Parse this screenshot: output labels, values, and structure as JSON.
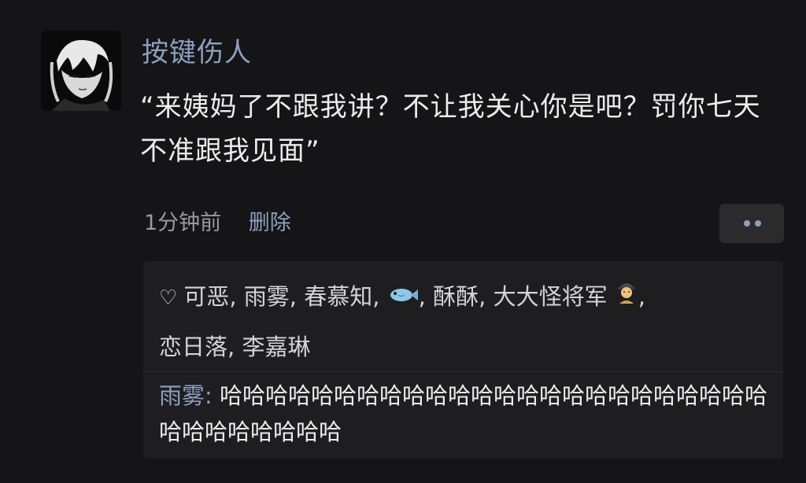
{
  "post": {
    "author": "按键伤人",
    "text": "“来姨妈了不跟我讲？不让我关心你是吧？罚你七天不准跟我见面”",
    "time": "1分钟前",
    "delete_label": "删除"
  },
  "likes": {
    "icon": "heart-outline-icon",
    "names": [
      "可恶",
      "雨雾",
      "春慕知",
      "",
      "酥酥",
      "大大怪将军",
      "恋日落",
      "李嘉琳"
    ],
    "emoji_names": [
      "fish-emoji-icon",
      "person-emoji-icon"
    ]
  },
  "reply": {
    "author": "雨雾",
    "separator": ": ",
    "text": "哈哈哈哈哈哈哈哈哈哈哈哈哈哈哈哈哈哈哈哈哈哈哈哈哈哈哈哈哈哈哈哈"
  },
  "more_menu": {
    "icon": "more-dots-icon"
  },
  "colors": {
    "background": "#151416",
    "panel": "#1e1d20",
    "link": "#8e9fc0",
    "text": "#ececec",
    "muted": "#9a9a9a"
  }
}
